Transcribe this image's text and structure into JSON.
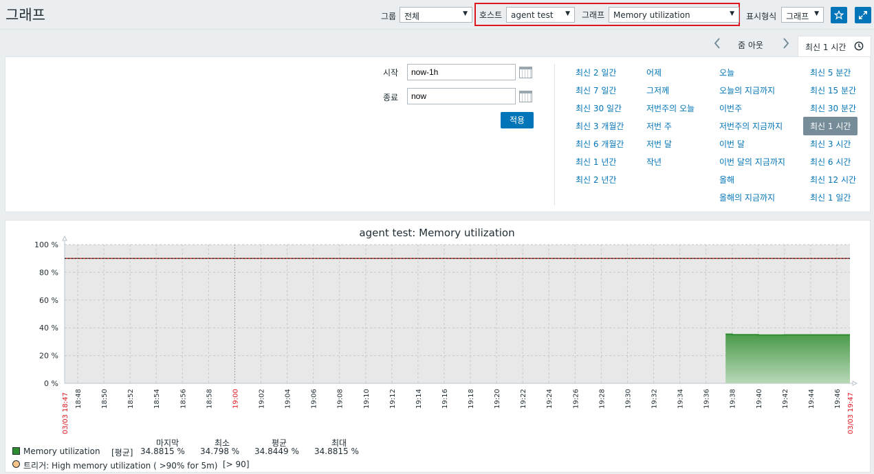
{
  "header": {
    "title": "그래프",
    "group_label": "그룹",
    "group_value": "전체",
    "host_label": "호스트",
    "host_value": "agent test",
    "graph_label": "그래프",
    "graph_value": "Memory utilization",
    "view_label": "표시형식",
    "view_value": "그래프",
    "star_icon": "star-icon",
    "fullscreen_icon": "fullscreen-icon"
  },
  "timeline": {
    "zoom_out_label": "줌 아웃",
    "active_tab_label": "최신 1 시간",
    "clock_icon": "clock-icon"
  },
  "filter": {
    "from_label": "시작",
    "from_value": "now-1h",
    "to_label": "종료",
    "to_value": "now",
    "apply_label": "적용",
    "quick": {
      "col1": [
        "최신 2 일간",
        "최신 7 일간",
        "최신 30 일간",
        "최신 3 개월간",
        "최신 6 개월간",
        "최신 1 년간",
        "최신 2 년간"
      ],
      "col2": [
        "어제",
        "그저께",
        "저번주의 오늘",
        "저번 주",
        "저번 달",
        "작년"
      ],
      "col3": [
        "오늘",
        "오늘의 지금까지",
        "이번주",
        "저번주의 지금까지",
        "이번 달",
        "이번 달의 지금까지",
        "올해",
        "올해의 지금까지"
      ],
      "col4": [
        "최신 5 분간",
        "최신 15 분간",
        "최신 30 분간",
        "최신 1 시간",
        "최신 3 시간",
        "최신 6 시간",
        "최신 12 시간",
        "최신 1 일간"
      ],
      "selected": "최신 1 시간"
    }
  },
  "graph": {
    "title": "agent test: Memory utilization",
    "colors": {
      "series": "#2e8b2e",
      "trigger": "#c0392b",
      "grid": "#c8c8c8",
      "bg": "#e8e8e8",
      "red_label": "#e0141e"
    },
    "legend": {
      "headers": [
        "마지막",
        "최소",
        "평균",
        "최대"
      ],
      "series_name": "Memory utilization",
      "series_func": "[평균]",
      "series_values": [
        "34.8815 %",
        "34.798 %",
        "34.8449 %",
        "34.8815 %"
      ],
      "trigger_text": "트리거: High memory utilization ( >90% for 5m)",
      "trigger_threshold": "[> 90]"
    }
  },
  "chart_data": {
    "type": "area",
    "title": "agent test: Memory utilization",
    "ylabel": "",
    "xlabel": "",
    "ylim": [
      0,
      100
    ],
    "y_ticks": [
      "0 %",
      "20 %",
      "40 %",
      "60 %",
      "80 %",
      "100 %"
    ],
    "x_start_label": "03/03 18:47",
    "x_end_label": "03/03 19:47",
    "x_ticks": [
      "18:48",
      "18:50",
      "18:52",
      "18:54",
      "18:56",
      "18:58",
      "19:00",
      "19:02",
      "19:04",
      "19:06",
      "19:08",
      "19:10",
      "19:12",
      "19:14",
      "19:16",
      "19:18",
      "19:20",
      "19:22",
      "19:24",
      "19:26",
      "19:28",
      "19:30",
      "19:32",
      "19:34",
      "19:36",
      "19:38",
      "19:40",
      "19:42",
      "19:44",
      "19:46"
    ],
    "trigger_threshold": 90,
    "series": [
      {
        "name": "Memory utilization",
        "x": [
          "19:37:30",
          "19:38",
          "19:39",
          "19:40",
          "19:41",
          "19:42",
          "19:43",
          "19:44",
          "19:45",
          "19:46",
          "19:47"
        ],
        "values": [
          35.4,
          35.0,
          35.0,
          34.8,
          34.8,
          34.9,
          34.9,
          34.9,
          34.88,
          34.88,
          34.88
        ]
      }
    ]
  }
}
